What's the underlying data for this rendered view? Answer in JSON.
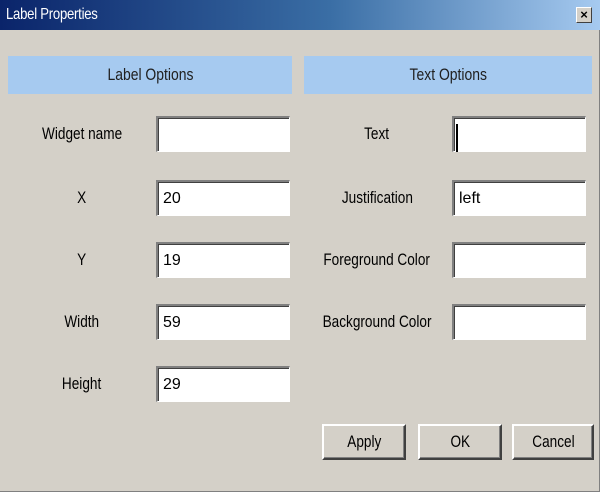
{
  "window": {
    "title": "Label Properties",
    "close_glyph": "×",
    "close_icon": "close-icon"
  },
  "label_options": {
    "header": "Label Options",
    "fields": [
      {
        "label": "Widget name",
        "value": ""
      },
      {
        "label": "X",
        "value": "20"
      },
      {
        "label": "Y",
        "value": "19"
      },
      {
        "label": "Width",
        "value": "59"
      },
      {
        "label": "Height",
        "value": "29"
      }
    ]
  },
  "text_options": {
    "header": "Text Options",
    "fields": [
      {
        "label": "Text",
        "value": ""
      },
      {
        "label": "Justification",
        "value": "left"
      },
      {
        "label": "Foreground Color",
        "value": ""
      },
      {
        "label": "Background Color",
        "value": ""
      }
    ]
  },
  "buttons": {
    "apply": "Apply",
    "ok": "OK",
    "cancel": "Cancel"
  },
  "colors": {
    "window_bg": "#d4d0c8",
    "section_header_bg": "#a6caf0",
    "titlebar_start": "#0a246a",
    "titlebar_end": "#a6caf0"
  }
}
